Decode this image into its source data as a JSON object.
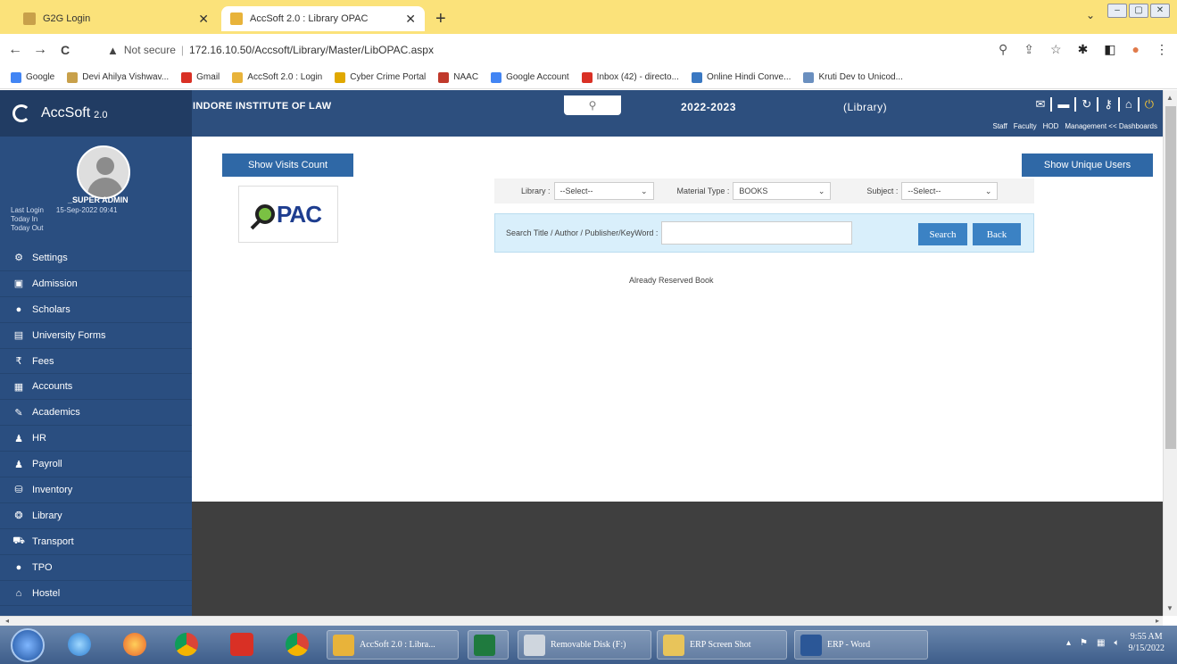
{
  "browser": {
    "tabs": [
      {
        "title": "G2G Login"
      },
      {
        "title": "AccSoft 2.0 : Library OPAC"
      }
    ],
    "new_tab": "+",
    "tab_menu": "⌄",
    "window_controls": [
      "–",
      "▢",
      "✕"
    ],
    "nav": {
      "back": "←",
      "forward": "→",
      "reload": "C"
    },
    "security_label": "Not secure",
    "url": "172.16.10.50/Accsoft/Library/Master/LibOPAC.aspx",
    "bookmarks": [
      {
        "label": "Google",
        "color": "#4285f4"
      },
      {
        "label": "Devi Ahilya Vishwav...",
        "color": "#c8a04a"
      },
      {
        "label": "Gmail",
        "color": "#d93025"
      },
      {
        "label": "AccSoft 2.0 : Login",
        "color": "#e8b33a"
      },
      {
        "label": "Cyber Crime Portal",
        "color": "#e0a800"
      },
      {
        "label": "NAAC",
        "color": "#c0392b"
      },
      {
        "label": "Google Account",
        "color": "#4285f4"
      },
      {
        "label": "Inbox (42) - directo...",
        "color": "#d93025"
      },
      {
        "label": "Online Hindi Conve...",
        "color": "#3a78c2"
      },
      {
        "label": "Kruti Dev to Unicod...",
        "color": "#6a8fbf"
      }
    ]
  },
  "app": {
    "brand": "AccSoft",
    "version": "2.0",
    "institute": "INDORE INSTITUTE OF LAW",
    "session": "2022-2023",
    "module": "(Library)",
    "header_links": [
      "Staff",
      "Faculty",
      "HOD",
      "Management << Dashboards"
    ],
    "colors": {
      "header": "#2d4f7e",
      "sidebar": "#2a4e80",
      "button": "#2f68a6"
    }
  },
  "user": {
    "name": "_SUPER ADMIN",
    "last_login_label": "Last Login",
    "last_login_value": "15-Sep-2022 09:41",
    "today_in": "Today In",
    "today_out": "Today Out"
  },
  "sidebar": {
    "items": [
      {
        "label": "Settings",
        "icon": "gear-icon"
      },
      {
        "label": "Admission",
        "icon": "id-card-icon"
      },
      {
        "label": "Scholars",
        "icon": "user-icon"
      },
      {
        "label": "University Forms",
        "icon": "form-icon"
      },
      {
        "label": "Fees",
        "icon": "rupee-icon"
      },
      {
        "label": "Accounts",
        "icon": "ledger-icon"
      },
      {
        "label": "Academics",
        "icon": "pencil-icon"
      },
      {
        "label": "HR",
        "icon": "users-icon"
      },
      {
        "label": "Payroll",
        "icon": "users-icon"
      },
      {
        "label": "Inventory",
        "icon": "box-icon"
      },
      {
        "label": "Library",
        "icon": "book-icon"
      },
      {
        "label": "Transport",
        "icon": "car-icon"
      },
      {
        "label": "TPO",
        "icon": "user-icon"
      },
      {
        "label": "Hostel",
        "icon": "home-icon"
      }
    ]
  },
  "main": {
    "show_visits_label": "Show Visits Count",
    "show_unique_label": "Show Unique Users",
    "opac_logo_text": "PAC",
    "filters": {
      "library_label": "Library :",
      "library_value": "--Select--",
      "material_label": "Material Type :",
      "material_value": "BOOKS",
      "subject_label": "Subject :",
      "subject_value": "--Select--"
    },
    "search_label": "Search Title / Author / Publisher/KeyWord :",
    "search_value": "",
    "search_button": "Search",
    "back_button": "Back",
    "reserved_text": "Already Reserved Book"
  },
  "taskbar": {
    "windows": [
      {
        "label": "AccSoft 2.0 : Libra...",
        "color": "#e8b33a"
      },
      {
        "label": "",
        "color": "#1f7a3e"
      },
      {
        "label": "Removable Disk (F:)",
        "color": "#cfd6de"
      },
      {
        "label": "ERP Screen Shot",
        "color": "#e8c45a"
      },
      {
        "label": "ERP - Word",
        "color": "#2b5797"
      }
    ],
    "time": "9:55 AM",
    "date": "9/15/2022"
  }
}
